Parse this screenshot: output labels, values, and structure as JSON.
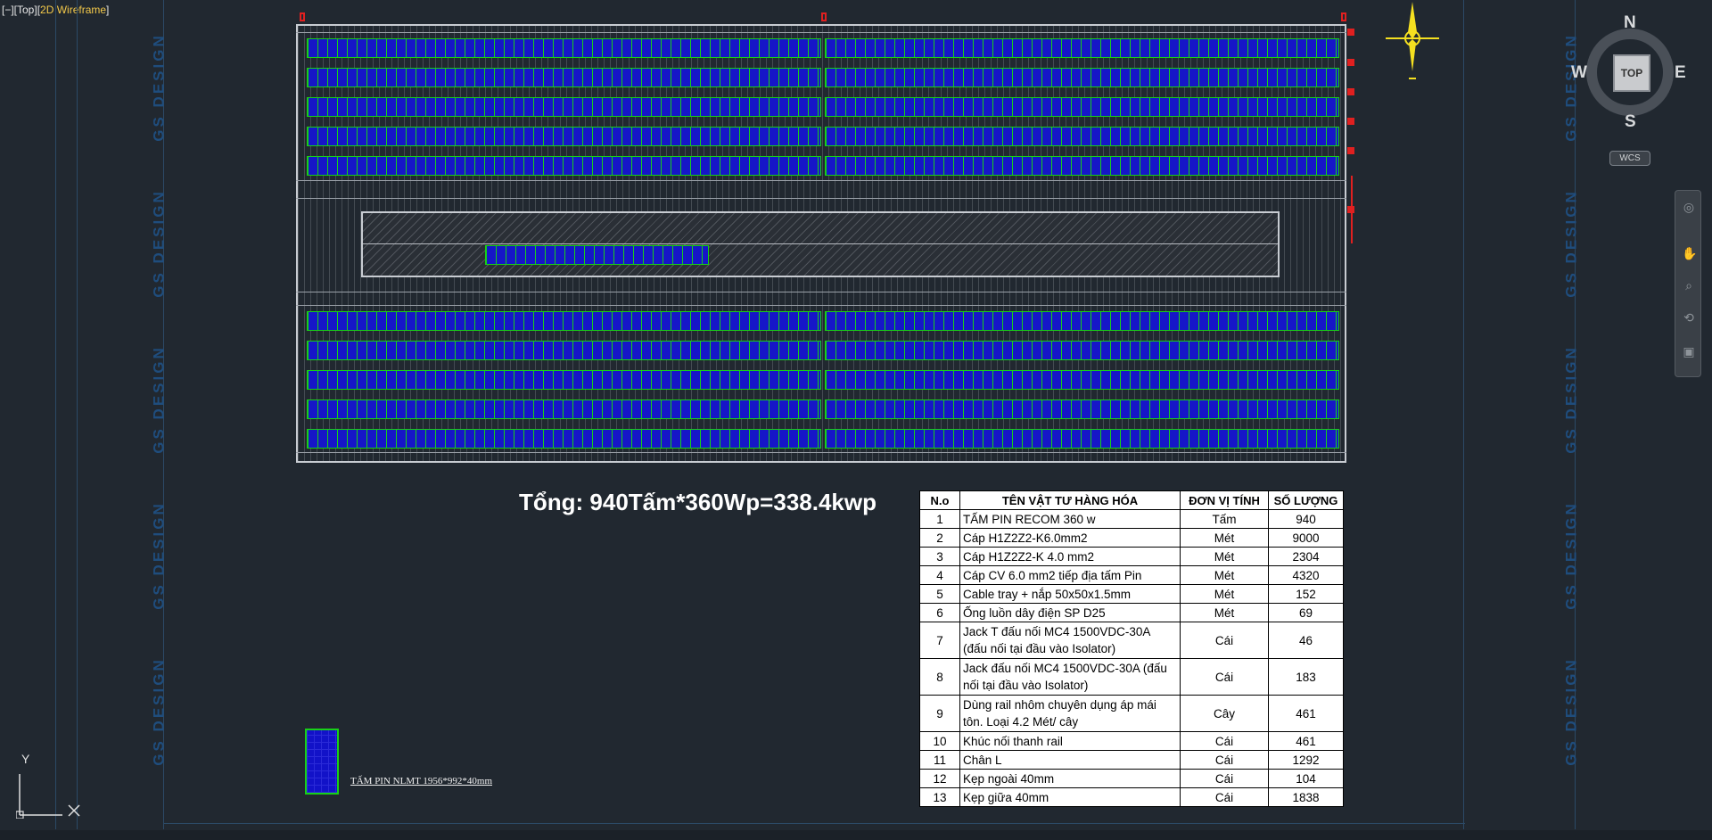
{
  "viewport": {
    "bracket_prefix": "[−][Top][",
    "visual_style": "2D Wireframe",
    "bracket_suffix": "]"
  },
  "watermark": {
    "text": "GS DESIGN"
  },
  "drawing": {
    "total_text": "Tổng: 940Tấm*360Wp=338.4kwp",
    "legend_text": "TẤM PIN NLMT 1956*992*40mm",
    "colors": {
      "background": "#212830",
      "panel_fill": "#1212c8",
      "panel_outline": "#18d018",
      "roof_outline": "#c8ccd2",
      "marker": "#e02020",
      "watermark": "#1f4f82"
    }
  },
  "bom_table": {
    "headers": {
      "no": "N.o",
      "name": "TÊN VẬT TƯ HÀNG HÓA",
      "unit": "ĐƠN VỊ TÍNH",
      "qty": "SỐ LƯỢNG"
    },
    "rows": [
      {
        "no": "1",
        "name": "TẤM PIN RECOM 360 w",
        "unit": "Tấm",
        "qty": "940"
      },
      {
        "no": "2",
        "name": "Cáp H1Z2Z2-K6.0mm2",
        "unit": "Mét",
        "qty": "9000"
      },
      {
        "no": "3",
        "name": "Cáp H1Z2Z2-K 4.0 mm2",
        "unit": "Mét",
        "qty": "2304"
      },
      {
        "no": "4",
        "name": "Cáp CV 6.0 mm2 tiếp địa tấm Pin",
        "unit": "Mét",
        "qty": "4320"
      },
      {
        "no": "5",
        "name": "Cable tray + nắp 50x50x1.5mm",
        "unit": "Mét",
        "qty": "152"
      },
      {
        "no": "6",
        "name": "Ống luồn dây điện SP D25",
        "unit": "Mét",
        "qty": "69"
      },
      {
        "no": "7",
        "name": "Jack T đấu nối MC4 1500VDC-30A (đấu nối tại đầu vào Isolator)",
        "unit": "Cái",
        "qty": "46"
      },
      {
        "no": "8",
        "name": "Jack đấu nối MC4 1500VDC-30A (đấu nối tại đầu vào Isolator)",
        "unit": "Cái",
        "qty": "183"
      },
      {
        "no": "9",
        "name": "Dùng rail nhôm chuyên dụng áp mái tôn. Loại 4.2 Mét/ cây",
        "unit": "Cây",
        "qty": "461"
      },
      {
        "no": "10",
        "name": "Khúc nối thanh rail",
        "unit": "Cái",
        "qty": "461"
      },
      {
        "no": "11",
        "name": " Chân L",
        "unit": "Cái",
        "qty": "1292"
      },
      {
        "no": "12",
        "name": "Kẹp ngoài  40mm",
        "unit": "Cái",
        "qty": "104"
      },
      {
        "no": "13",
        "name": "Kẹp giữa 40mm",
        "unit": "Cái",
        "qty": "1838"
      }
    ]
  },
  "viewcube": {
    "north": "N",
    "south": "S",
    "east": "E",
    "west": "W",
    "face": "TOP",
    "wcs": "WCS"
  },
  "ucs": {
    "y_label": "Y",
    "x_label": "X"
  },
  "navigation_bar": {
    "tools": [
      "steering-wheel-icon",
      "pan-icon",
      "zoom-icon",
      "orbit-icon",
      "showmotion-icon"
    ]
  }
}
